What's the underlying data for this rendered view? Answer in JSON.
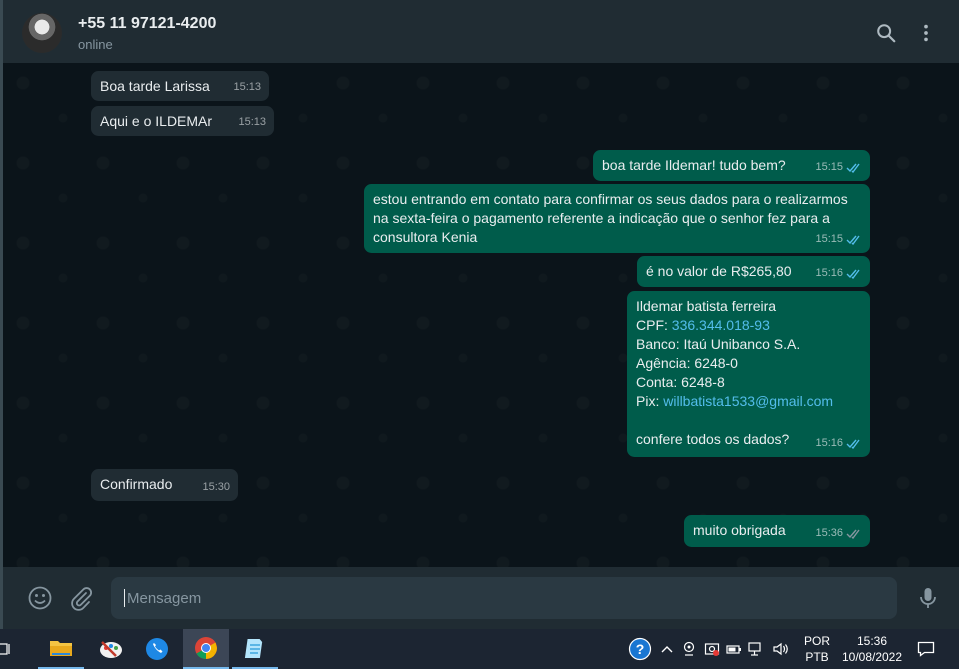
{
  "header": {
    "contact_name": "+55 11 97121-4200",
    "status": "online"
  },
  "messages": [
    {
      "dir": "in",
      "text": "Boa tarde Larissa",
      "time": "15:13"
    },
    {
      "dir": "in",
      "text": "Aqui e o ILDEMAr",
      "time": "15:13"
    },
    {
      "dir": "out",
      "text": "boa tarde Ildemar! tudo bem?",
      "time": "15:15"
    },
    {
      "dir": "out",
      "text": "estou entrando em contato para confirmar os seus dados para o realizarmos na sexta-feira o pagamento referente a indicação que o senhor fez para a consultora Kenia",
      "time": "15:15"
    },
    {
      "dir": "out",
      "text": "é no valor de R$265,80",
      "time": "15:16"
    },
    {
      "dir": "out",
      "time": "15:16",
      "lines": {
        "name": "Ildemar batista ferreira",
        "cpf_label": "CPF: ",
        "cpf_value": "336.344.018-93",
        "bank": "Banco: Itaú Unibanco S.A.",
        "agency": "Agência: 6248-0",
        "account": "Conta: 6248-8",
        "pix_label": "Pix: ",
        "pix_value": "willbatista1533@gmail.com",
        "question": "confere todos os dados?"
      }
    },
    {
      "dir": "in",
      "text": "Confirmado",
      "time": "15:30"
    },
    {
      "dir": "out",
      "text": "muito obrigada",
      "time": "15:36"
    }
  ],
  "composer": {
    "placeholder": "Mensagem"
  },
  "taskbar": {
    "language_top": "POR",
    "language_bottom": "PTB",
    "clock_time": "15:36",
    "clock_date": "10/08/2022"
  },
  "colors": {
    "incoming_bubble": "#202c33",
    "outgoing_bubble": "#005c4b",
    "link": "#53bdeb",
    "background": "#0b141a"
  },
  "icons": [
    "search-icon",
    "menu-icon",
    "emoji-icon",
    "attach-icon",
    "mic-icon",
    "double-check-icon"
  ]
}
